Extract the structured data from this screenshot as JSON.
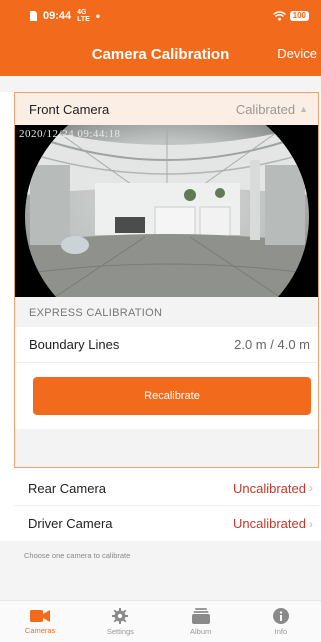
{
  "status_bar": {
    "time": "09:44",
    "battery": "100"
  },
  "nav": {
    "title": "Camera Calibration",
    "right": "Device"
  },
  "front_camera": {
    "label": "Front Camera",
    "status": "Calibrated",
    "timestamp": "2020/12/24 09:44:18",
    "section_label": "EXPRESS CALIBRATION",
    "boundary_label": "Boundary Lines",
    "boundary_value": "2.0 m / 4.0 m",
    "button_label": "Recalibrate"
  },
  "cameras": [
    {
      "label": "Rear Camera",
      "status": "Uncalibrated"
    },
    {
      "label": "Driver Camera",
      "status": "Uncalibrated"
    }
  ],
  "hint": "Choose one camera to calibrate",
  "tabs": [
    {
      "label": "Cameras",
      "icon": "camera-icon",
      "active": true
    },
    {
      "label": "Settings",
      "icon": "gear-icon",
      "active": false
    },
    {
      "label": "Album",
      "icon": "album-icon",
      "active": false
    },
    {
      "label": "Info",
      "icon": "info-icon",
      "active": false
    }
  ],
  "colors": {
    "accent": "#f26b1d",
    "warning": "#c0392b",
    "calibrated_header": "#fbeee5"
  }
}
